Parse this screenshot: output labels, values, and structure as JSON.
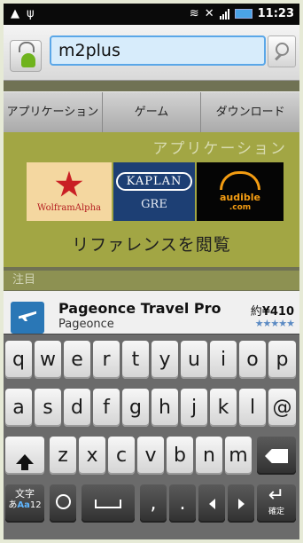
{
  "status_bar": {
    "left_icons": [
      "warning-icon",
      "usb-icon"
    ],
    "right_icons": [
      "wifi-icon",
      "mute-icon",
      "signal-icon",
      "battery-icon"
    ],
    "time": "11:23"
  },
  "search": {
    "query": "m2plus"
  },
  "market": {
    "tabs": [
      "アプリケーション",
      "ゲーム",
      "ダウンロード"
    ],
    "banner": {
      "title": "アプリケーション",
      "tiles": [
        {
          "name": "WolframAlpha"
        },
        {
          "name": "KAPLAN",
          "sub": "GRE"
        },
        {
          "name": "audible",
          "sub": ".com"
        }
      ],
      "caption": "リファレンスを閲覧"
    },
    "section_label": "注目",
    "featured": {
      "name": "Pageonce Travel Pro",
      "developer": "Pageonce",
      "price_prefix": "約",
      "price": "¥410",
      "rating": "★★★★★"
    }
  },
  "keyboard": {
    "row1": [
      "q",
      "w",
      "e",
      "r",
      "t",
      "y",
      "u",
      "i",
      "o",
      "p"
    ],
    "row2": [
      "a",
      "s",
      "d",
      "f",
      "g",
      "h",
      "j",
      "k",
      "l",
      "@"
    ],
    "row3": [
      "z",
      "x",
      "c",
      "v",
      "b",
      "n",
      "m"
    ],
    "row4": {
      "mode_top": "文字",
      "mode_sub_a": "あ",
      "mode_sub_b": "Aa",
      "mode_sub_c": "12",
      "comma": ",",
      "period": ".",
      "enter_label": "確定"
    }
  }
}
